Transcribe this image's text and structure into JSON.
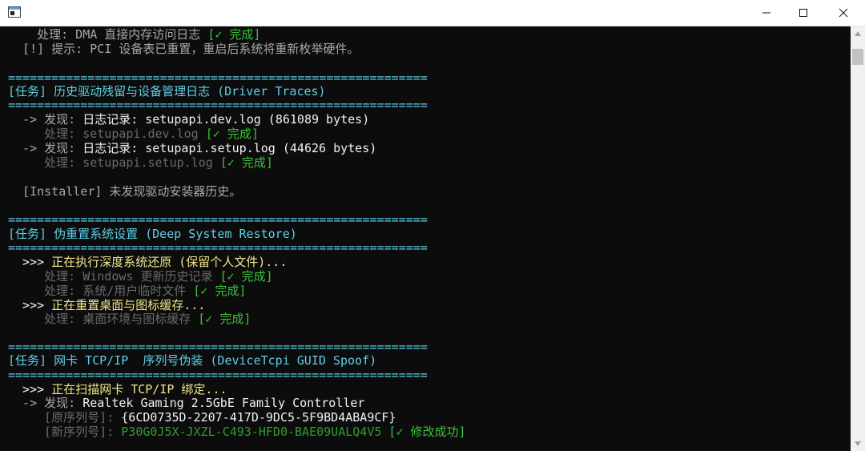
{
  "window": {
    "icon": "console-window-icon"
  },
  "controls": {
    "minimize": "minimize-icon",
    "maximize": "maximize-icon",
    "close": "close-icon"
  },
  "console": {
    "l1": {
      "pre": "    处理: DMA 直接内存访问日志 ",
      "status": "[✓ 完成]"
    },
    "l2": {
      "text": "  [!] 提示: PCI 设备表已重置，重启后系统将重新枚举硬件。"
    },
    "sep": "==========================================================",
    "t1": {
      "text": "[任务] 历史驱动残留与设备管理日志 (Driver Traces)"
    },
    "l6": {
      "arrow": "  -> 发现: ",
      "item": "日志记录: setupapi.dev.log (861089 bytes)"
    },
    "l7": {
      "pre": "     处理: setupapi.dev.log ",
      "status": "[✓ 完成]"
    },
    "l8": {
      "arrow": "  -> 发现: ",
      "item": "日志记录: setupapi.setup.log (44626 bytes)"
    },
    "l9": {
      "pre": "     处理: setupapi.setup.log ",
      "status": "[✓ 完成]"
    },
    "l10": {
      "text": "  [Installer] 未发现驱动安装器历史。"
    },
    "t2": {
      "text": "[任务] 伪重置系统设置 (Deep System Restore)"
    },
    "l15": {
      "prompt": "  >>> ",
      "text": "正在执行深度系统还原 (保留个人文件)..."
    },
    "l16": {
      "pre": "     处理: Windows 更新历史记录 ",
      "status": "[✓ 完成]"
    },
    "l17": {
      "pre": "     处理: 系统/用户临时文件 ",
      "status": "[✓ 完成]"
    },
    "l18": {
      "prompt": "  >>> ",
      "text": "正在重置桌面与图标缓存..."
    },
    "l19": {
      "pre": "     处理: 桌面环境与图标缓存 ",
      "status": "[✓ 完成]"
    },
    "t3": {
      "text": "[任务] 网卡 TCP/IP  序列号伪装 (DeviceTcpi GUID Spoof)"
    },
    "l24": {
      "prompt": "  >>> ",
      "text": "正在扫描网卡 TCP/IP 绑定..."
    },
    "l25": {
      "arrow": "  -> 发现: ",
      "item": "Realtek Gaming 2.5GbE Family Controller"
    },
    "l26": {
      "label": "     [原序列号]: ",
      "value": "{6CD0735D-2207-417D-9DC5-5F9BD4ABA9CF}"
    },
    "l27": {
      "label": "     [新序列号]: ",
      "value": "P30G0J5X-JXZL-C493-HFD0-BAE09UALQ4V5",
      "status": " [✓ 修改成功]"
    }
  }
}
